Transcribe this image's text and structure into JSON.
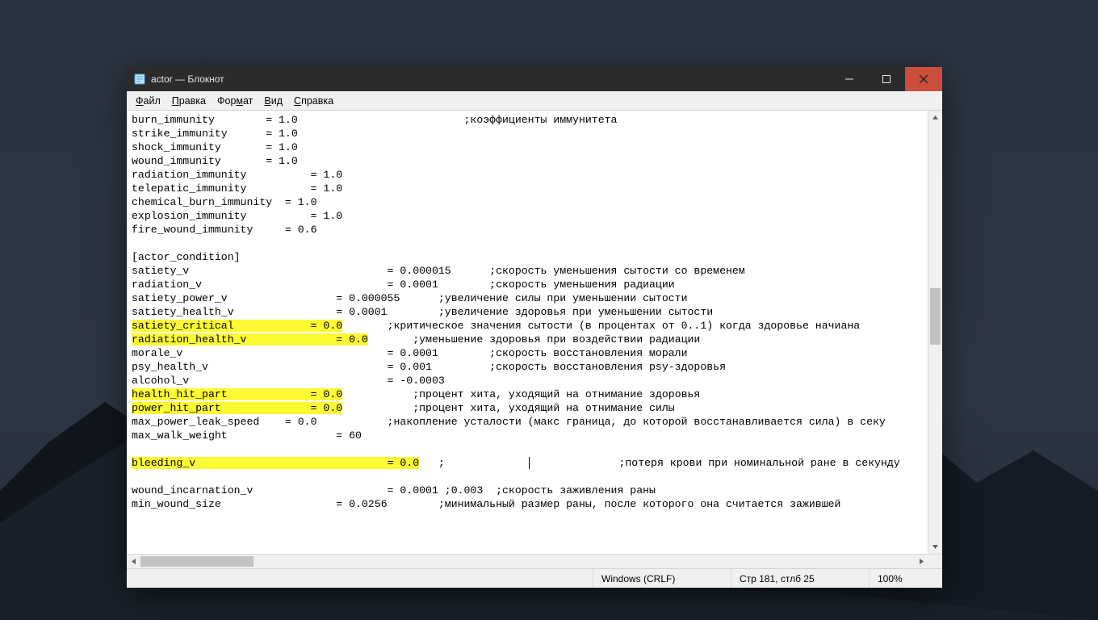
{
  "window": {
    "title": "actor — Блокнот"
  },
  "menu": {
    "file": "Файл",
    "edit": "Правка",
    "format": "Формат",
    "view": "Вид",
    "help": "Справка"
  },
  "status": {
    "line_ending": "Windows (CRLF)",
    "position": "Стр 181, стлб 25",
    "zoom": "100%"
  },
  "highlight_color": "#fdf932",
  "editor_lines": [
    {
      "key": "burn_immunity",
      "eq_col": 21,
      "value": "1.0",
      "comment": ";коэффициенты иммунитета",
      "comment_col": 52
    },
    {
      "key": "strike_immunity",
      "eq_col": 21,
      "value": "1.0"
    },
    {
      "key": "shock_immunity",
      "eq_col": 21,
      "value": "1.0"
    },
    {
      "key": "wound_immunity",
      "eq_col": 21,
      "value": "1.0"
    },
    {
      "key": "radiation_immunity",
      "eq_col": 28,
      "value": "1.0"
    },
    {
      "key": "telepatic_immunity",
      "eq_col": 28,
      "value": "1.0"
    },
    {
      "key": "chemical_burn_immunity",
      "eq_col": 24,
      "value": "1.0"
    },
    {
      "key": "explosion_immunity",
      "eq_col": 28,
      "value": "1.0"
    },
    {
      "key": "fire_wound_immunity",
      "eq_col": 24,
      "value": "0.6"
    },
    {
      "blank": true
    },
    {
      "raw": "[actor_condition]"
    },
    {
      "key": "satiety_v",
      "eq_col": 40,
      "value": "0.000015",
      "comment": ";скорость уменьшения сытости со временем",
      "comment_col": 56
    },
    {
      "key": "radiation_v",
      "eq_col": 40,
      "value": "0.0001",
      "comment": ";скорость уменьшения радиации",
      "comment_col": 56
    },
    {
      "key": "satiety_power_v",
      "eq_col": 32,
      "value": "0.000055",
      "comment": ";увеличение силы при уменьшении сытости",
      "comment_col": 48
    },
    {
      "key": "satiety_health_v",
      "eq_col": 32,
      "value": "0.0001",
      "comment": ";увеличение здоровья при уменьшении сытости",
      "comment_col": 48
    },
    {
      "key": "satiety_critical",
      "eq_col": 28,
      "value": "0.0",
      "comment": ";критическое значения сытости (в процентах от 0..1) когда здоровье начиана",
      "comment_col": 40,
      "highlight": true
    },
    {
      "key": "radiation_health_v",
      "eq_col": 32,
      "value": "0.0",
      "comment": ";уменьшение здоровья при воздействии радиации",
      "comment_col": 44,
      "highlight": true
    },
    {
      "key": "morale_v",
      "eq_col": 40,
      "value": "0.0001",
      "comment": ";скорость восстановления морали",
      "comment_col": 56
    },
    {
      "key": "psy_health_v",
      "eq_col": 40,
      "value": "0.001",
      "comment": ";скорость восстановления psy-здоровья",
      "comment_col": 56
    },
    {
      "key": "alcohol_v",
      "eq_col": 40,
      "value": "-0.0003"
    },
    {
      "key": "health_hit_part",
      "eq_col": 28,
      "value": "0.0",
      "comment": ";процент хита, уходящий на отнимание здоровья",
      "comment_col": 44,
      "highlight": true
    },
    {
      "key": "power_hit_part",
      "eq_col": 28,
      "value": "0.0",
      "comment": ";процент хита, уходящий на отнимание силы",
      "comment_col": 44,
      "highlight": true
    },
    {
      "key": "max_power_leak_speed",
      "eq_col": 24,
      "value": "0.0",
      "comment": ";накопление усталости (макс граница, до которой восстанавливается сила) в секу",
      "comment_col": 40
    },
    {
      "key": "max_walk_weight",
      "eq_col": 32,
      "value": "60"
    },
    {
      "blank": true
    },
    {
      "key": "bleeding_v",
      "eq_col": 40,
      "value": "0.0",
      "comment": ";         |         ;потеря крови при номинальной ране в секунду",
      "comment_col": 48,
      "highlight": true,
      "cursor_after_value": true
    },
    {
      "blank": true
    },
    {
      "key": "wound_incarnation_v",
      "eq_col": 40,
      "value": "0.0001 ;0.003",
      "comment": ";скорость заживления раны",
      "comment_col": 57
    },
    {
      "key": "min_wound_size",
      "eq_col": 32,
      "value": "0.0256",
      "comment": ";минимальный размер раны, после которого она считается зажившей",
      "comment_col": 48
    }
  ]
}
